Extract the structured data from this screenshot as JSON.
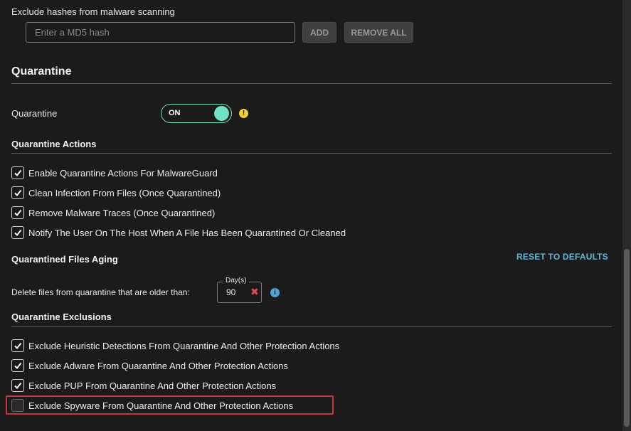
{
  "exclude_hashes": {
    "label": "Exclude hashes from malware scanning",
    "input_placeholder": "Enter a MD5 hash",
    "input_value": "",
    "add_label": "ADD",
    "remove_all_label": "REMOVE ALL"
  },
  "quarantine": {
    "section_title": "Quarantine",
    "toggle_label": "Quarantine",
    "toggle_state": "ON",
    "warning_icon": "exclamation-icon"
  },
  "actions": {
    "title": "Quarantine Actions",
    "items": [
      {
        "label": "Enable Quarantine Actions For MalwareGuard",
        "checked": true
      },
      {
        "label": "Clean Infection From Files (Once Quarantined)",
        "checked": true
      },
      {
        "label": "Remove Malware Traces (Once Quarantined)",
        "checked": true
      },
      {
        "label": "Notify The User On The Host When A File Has Been Quarantined Or Cleaned",
        "checked": true
      }
    ]
  },
  "aging": {
    "title": "Quarantined Files Aging",
    "reset_label": "RESET TO DEFAULTS",
    "delete_label": "Delete files from quarantine that are older than:",
    "days_legend": "Day(s)",
    "days_value": "90"
  },
  "exclusions": {
    "title": "Quarantine Exclusions",
    "items": [
      {
        "label": "Exclude Heuristic Detections From Quarantine And Other Protection Actions",
        "checked": true
      },
      {
        "label": "Exclude Adware From Quarantine And Other Protection Actions",
        "checked": true
      },
      {
        "label": "Exclude PUP From Quarantine And Other Protection Actions",
        "checked": true
      },
      {
        "label": "Exclude Spyware From Quarantine And Other Protection Actions",
        "checked": false
      }
    ]
  },
  "colors": {
    "accent": "#6fe3c6",
    "link": "#5fb8d6",
    "warning": "#f2d22a",
    "info": "#4aa8de",
    "danger": "#c8353f"
  }
}
